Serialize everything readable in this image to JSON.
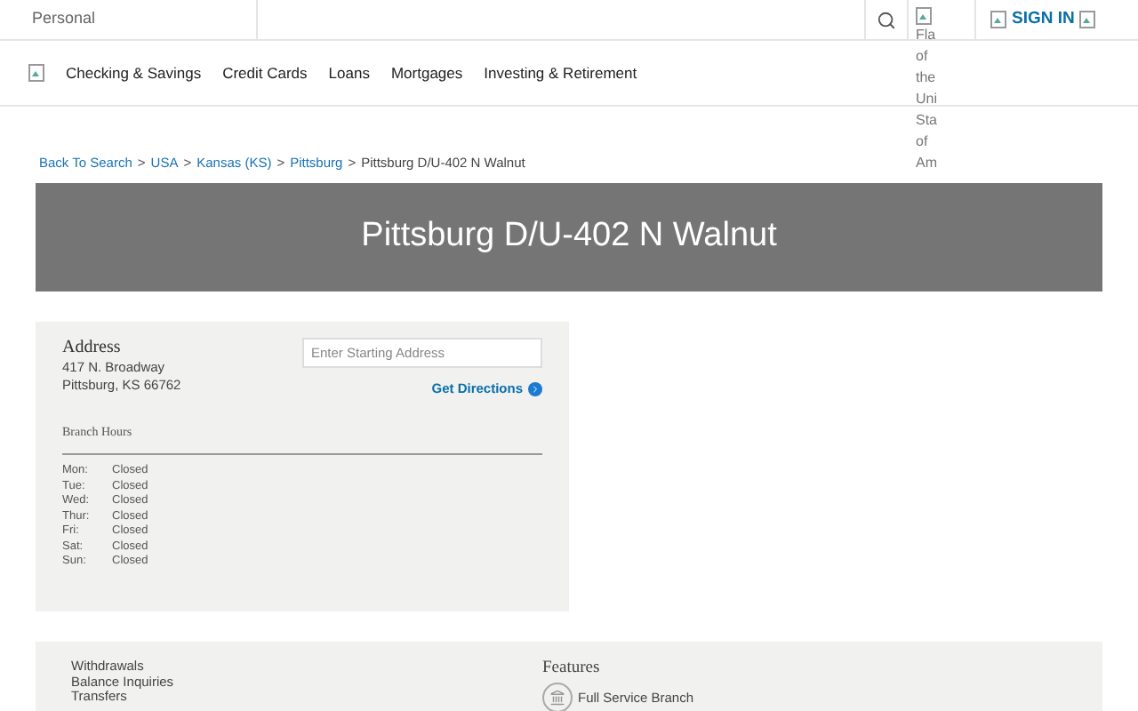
{
  "top_bar": {
    "segment": "Personal",
    "flag_alt_lines": [
      "Fla",
      "of",
      "the",
      "Uni",
      "Sta",
      "of",
      "Am"
    ],
    "sign_in": "SIGN IN"
  },
  "nav": {
    "items": [
      "Checking & Savings",
      "Credit Cards",
      "Loans",
      "Mortgages",
      "Investing & Retirement"
    ]
  },
  "breadcrumb": {
    "links": [
      "Back To Search",
      "USA",
      "Kansas (KS)",
      "Pittsburg"
    ],
    "current": "Pittsburg D/U-402 N Walnut",
    "separator": ">"
  },
  "banner": {
    "title": "Pittsburg D/U-402 N Walnut"
  },
  "address_card": {
    "heading": "Address",
    "lines": [
      "417 N. Broadway",
      "Pittsburg, KS 66762"
    ],
    "start_field": {
      "placeholder": "Enter Starting Address"
    },
    "directions": "Get Directions",
    "hours_heading": "Branch Hours",
    "hours": [
      {
        "day": "Mon:",
        "time": "Closed"
      },
      {
        "day": "Tue:",
        "time": "Closed"
      },
      {
        "day": "Wed:",
        "time": "Closed"
      },
      {
        "day": "Thur:",
        "time": "Closed"
      },
      {
        "day": "Fri:",
        "time": "Closed"
      },
      {
        "day": "Sat:",
        "time": "Closed"
      },
      {
        "day": "Sun:",
        "time": "Closed"
      }
    ]
  },
  "services_card": {
    "services": [
      "Withdrawals",
      "Balance Inquiries",
      "Transfers"
    ],
    "features_heading": "Features",
    "features": [
      "Full Service Branch"
    ]
  }
}
